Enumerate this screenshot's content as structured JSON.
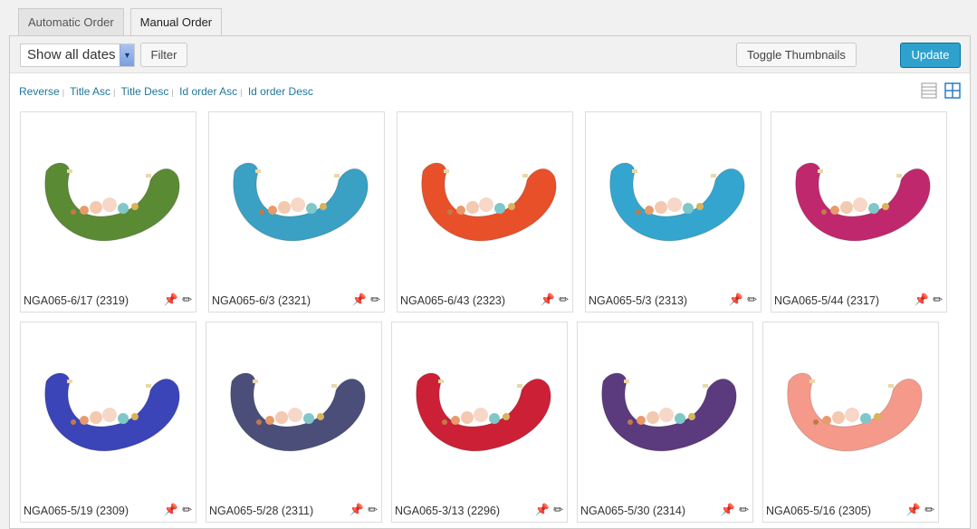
{
  "tabs": [
    "Automatic Order",
    "Manual Order"
  ],
  "toolbar": {
    "date_select": "Show all dates",
    "filter": "Filter",
    "toggle": "Toggle Thumbnails",
    "update": "Update"
  },
  "sort_links": [
    "Reverse",
    "Title Asc",
    "Title Desc",
    "Id order Asc",
    "Id order Desc"
  ],
  "items": [
    {
      "label": "NGA065-6/17 (2319)",
      "color": "#5b8a35"
    },
    {
      "label": "NGA065-6/3 (2321)",
      "color": "#3aa0c4"
    },
    {
      "label": "NGA065-6/43 (2323)",
      "color": "#e8502a"
    },
    {
      "label": "NGA065-5/3 (2313)",
      "color": "#34a5cf"
    },
    {
      "label": "NGA065-5/44 (2317)",
      "color": "#c0286e"
    },
    {
      "label": "NGA065-5/19 (2309)",
      "color": "#3b45b8"
    },
    {
      "label": "NGA065-5/28 (2311)",
      "color": "#4c4e7a"
    },
    {
      "label": "NGA065-3/13 (2296)",
      "color": "#cc2036"
    },
    {
      "label": "NGA065-5/30 (2314)",
      "color": "#5b3a7e"
    },
    {
      "label": "NGA065-5/16 (2305)",
      "color": "#f59a8a"
    }
  ]
}
